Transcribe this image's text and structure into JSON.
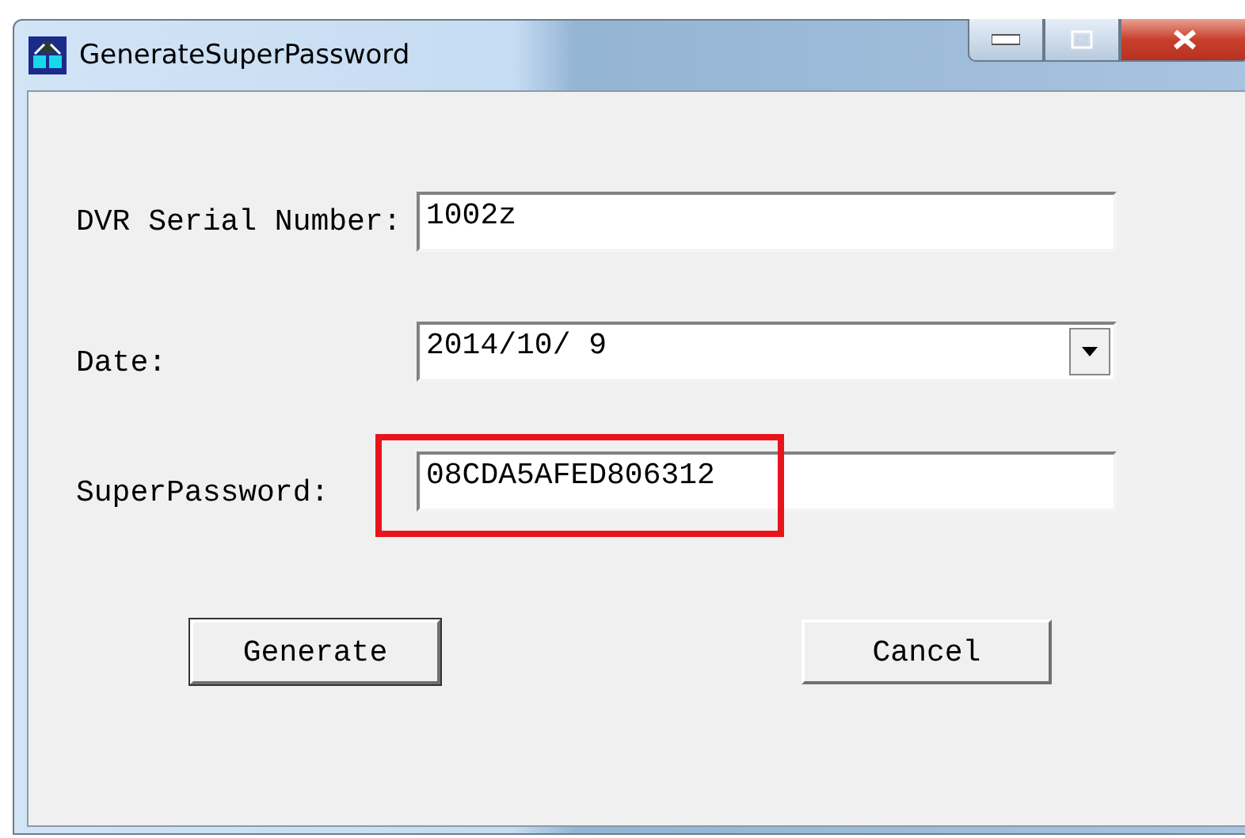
{
  "window": {
    "title": "GenerateSuperPassword"
  },
  "fields": [
    {
      "label": "DVR Serial Number:",
      "value": "1002z",
      "kind": "text",
      "highlighted": false
    },
    {
      "label": "Date:",
      "value": "2014/10/ 9",
      "kind": "dropdown",
      "highlighted": false
    },
    {
      "label": "SuperPassword:",
      "value": "08CDA5AFED806312",
      "kind": "text",
      "highlighted": true
    }
  ],
  "buttons": [
    {
      "label": "Generate",
      "default": true
    },
    {
      "label": "Cancel",
      "default": false
    }
  ]
}
